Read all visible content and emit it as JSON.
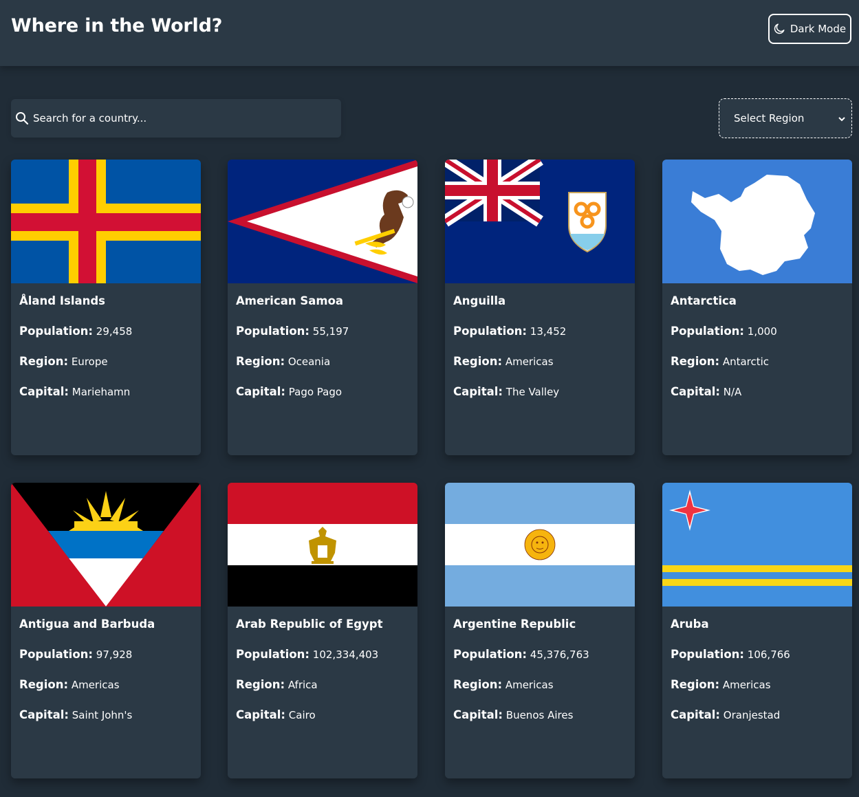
{
  "header": {
    "title": "Where in the World?",
    "theme_toggle_label": "Dark Mode"
  },
  "search": {
    "placeholder": "Search for a country..."
  },
  "filter": {
    "selected": "Select Region"
  },
  "field_labels": {
    "population": "Population:",
    "region": "Region:",
    "capital": "Capital:"
  },
  "countries": [
    {
      "name": "Åland Islands",
      "population": "29,458",
      "region": "Europe",
      "capital": "Mariehamn",
      "flag_icon": "flag-aland-icon"
    },
    {
      "name": "American Samoa",
      "population": "55,197",
      "region": "Oceania",
      "capital": "Pago Pago",
      "flag_icon": "flag-american-samoa-icon"
    },
    {
      "name": "Anguilla",
      "population": "13,452",
      "region": "Americas",
      "capital": "The Valley",
      "flag_icon": "flag-anguilla-icon"
    },
    {
      "name": "Antarctica",
      "population": "1,000",
      "region": "Antarctic",
      "capital": "N/A",
      "flag_icon": "flag-antarctica-icon"
    },
    {
      "name": "Antigua and Barbuda",
      "population": "97,928",
      "region": "Americas",
      "capital": "Saint John's",
      "flag_icon": "flag-antigua-icon"
    },
    {
      "name": "Arab Republic of Egypt",
      "population": "102,334,403",
      "region": "Africa",
      "capital": "Cairo",
      "flag_icon": "flag-egypt-icon"
    },
    {
      "name": "Argentine Republic",
      "population": "45,376,763",
      "region": "Americas",
      "capital": "Buenos Aires",
      "flag_icon": "flag-argentina-icon"
    },
    {
      "name": "Aruba",
      "population": "106,766",
      "region": "Americas",
      "capital": "Oranjestad",
      "flag_icon": "flag-aruba-icon"
    }
  ],
  "colors": {
    "background": "#202c37",
    "elements": "#2b3945",
    "text": "#ffffff"
  }
}
